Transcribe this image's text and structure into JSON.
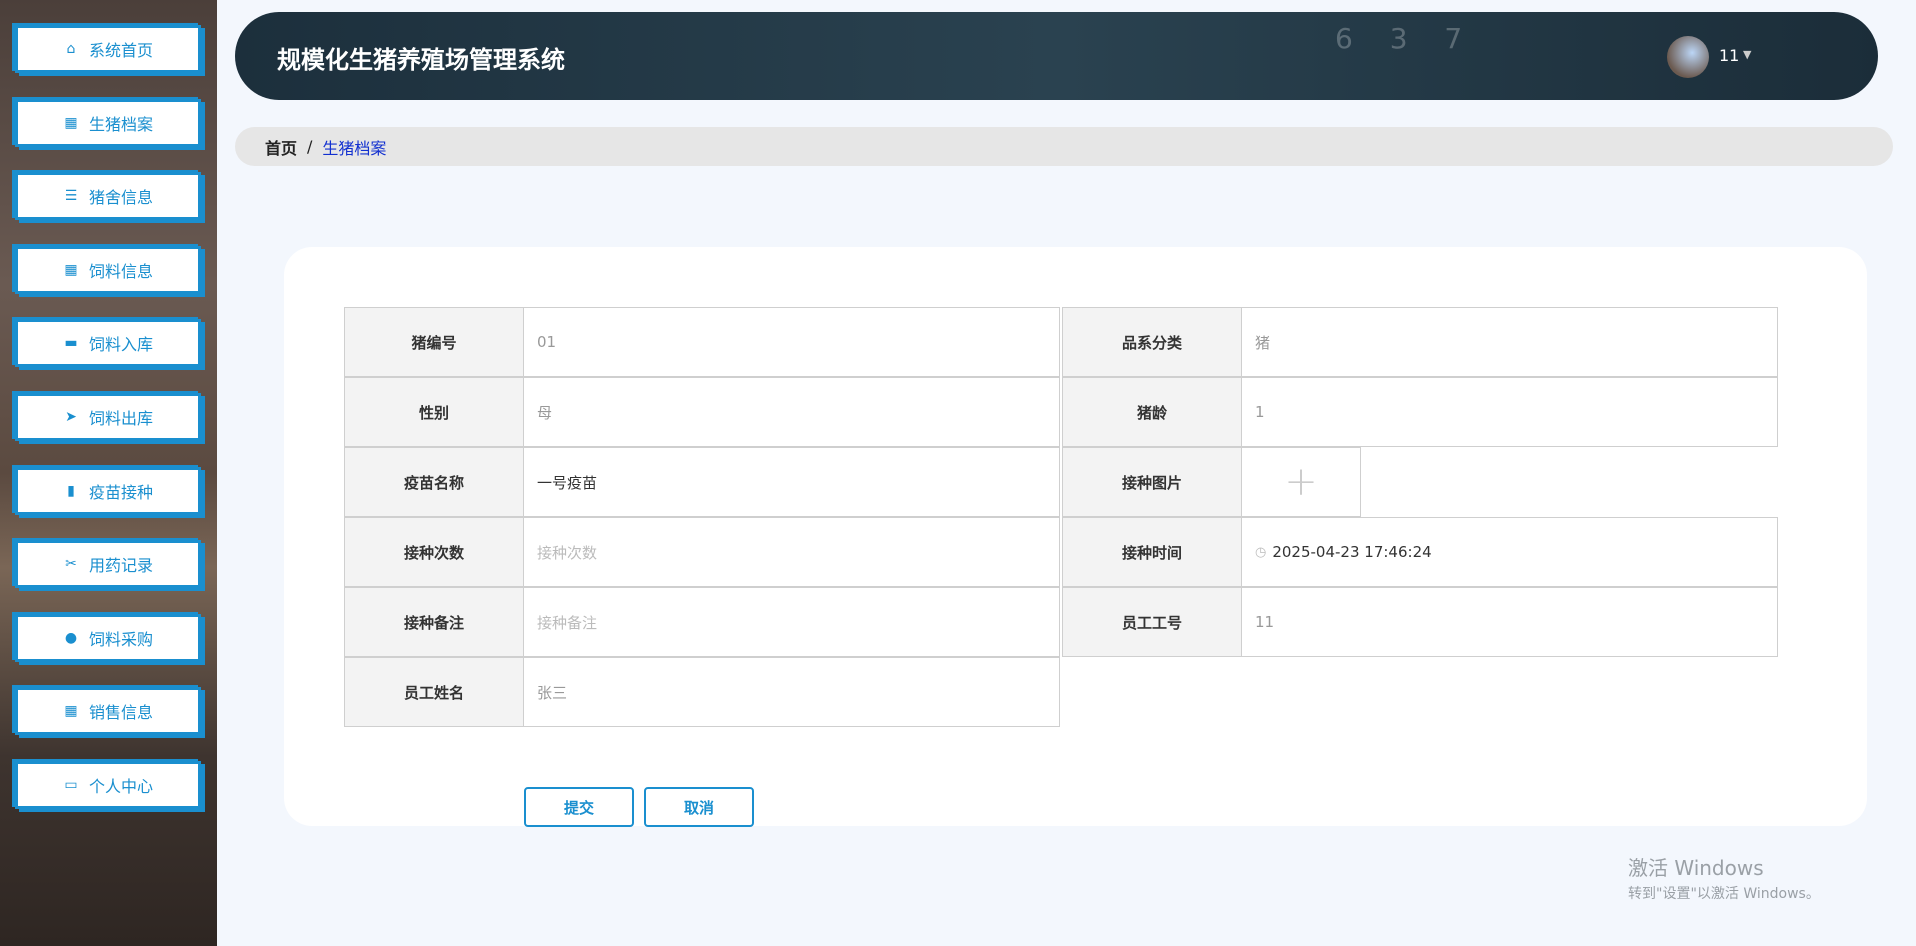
{
  "sidebar": {
    "items": [
      {
        "label": "系统首页",
        "icon": "home-icon",
        "glyph": "⌂"
      },
      {
        "label": "生猪档案",
        "icon": "grid-icon",
        "glyph": "▦"
      },
      {
        "label": "猪舍信息",
        "icon": "list-icon",
        "glyph": "☰"
      },
      {
        "label": "饲料信息",
        "icon": "grid-icon",
        "glyph": "▦"
      },
      {
        "label": "饲料入库",
        "icon": "monitor-icon",
        "glyph": "▬"
      },
      {
        "label": "饲料出库",
        "icon": "send-icon",
        "glyph": "➤"
      },
      {
        "label": "疫苗接种",
        "icon": "book-icon",
        "glyph": "▮"
      },
      {
        "label": "用药记录",
        "icon": "ticket-icon",
        "glyph": "✂"
      },
      {
        "label": "饲料采购",
        "icon": "bulb-icon",
        "glyph": "●"
      },
      {
        "label": "销售信息",
        "icon": "grid-icon",
        "glyph": "▦"
      },
      {
        "label": "个人中心",
        "icon": "card-icon",
        "glyph": "▭"
      }
    ]
  },
  "header": {
    "title": "规模化生猪养殖场管理系统",
    "username": "11",
    "deco": "6 3 7"
  },
  "breadcrumb": {
    "home": "首页",
    "sep": "/",
    "current": "生猪档案"
  },
  "form": {
    "pig_no": {
      "label": "猪编号",
      "value": "01"
    },
    "breed": {
      "label": "品系分类",
      "value": "猪"
    },
    "sex": {
      "label": "性别",
      "value": "母"
    },
    "age": {
      "label": "猪龄",
      "value": "1"
    },
    "vaccine": {
      "label": "疫苗名称",
      "value": "一号疫苗"
    },
    "image": {
      "label": "接种图片",
      "glyph": "+"
    },
    "times": {
      "label": "接种次数",
      "placeholder": "接种次数"
    },
    "time": {
      "label": "接种时间",
      "value": "2025-04-23 17:46:24"
    },
    "note": {
      "label": "接种备注",
      "placeholder": "接种备注"
    },
    "emp_no": {
      "label": "员工工号",
      "value": "11"
    },
    "emp_name": {
      "label": "员工姓名",
      "value": "张三"
    },
    "submit": "提交",
    "cancel": "取消"
  },
  "watermark": {
    "line1": "激活 Windows",
    "line2": "转到\"设置\"以激活 Windows。"
  }
}
